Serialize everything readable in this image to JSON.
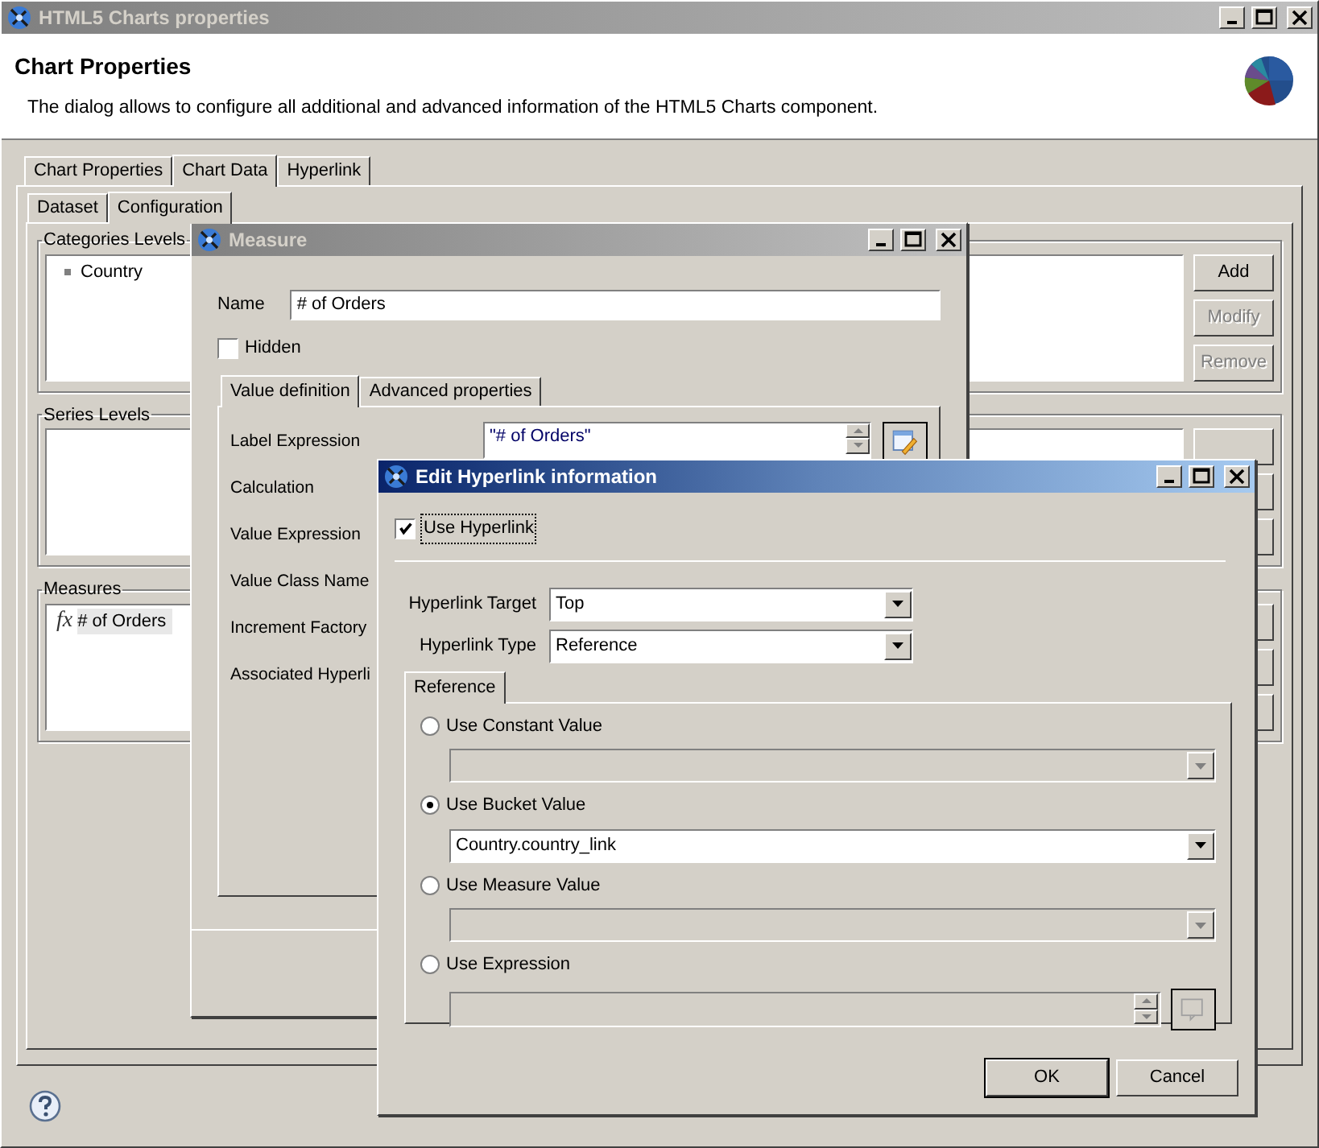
{
  "window": {
    "title": "HTML5 Charts properties",
    "active": false
  },
  "header": {
    "title": "Chart Properties",
    "description": "The dialog allows to configure all additional and advanced information of the HTML5 Charts component."
  },
  "tabs": [
    {
      "label": "Chart Properties",
      "selected": false
    },
    {
      "label": "Chart Data",
      "selected": true
    },
    {
      "label": "Hyperlink",
      "selected": false
    }
  ],
  "subtabs": [
    {
      "label": "Dataset",
      "selected": false
    },
    {
      "label": "Configuration",
      "selected": true
    }
  ],
  "categories_levels": {
    "title": "Categories Levels",
    "items": [
      "Country"
    ],
    "buttons": [
      {
        "label": "Add",
        "disabled": false
      },
      {
        "label": "Modify",
        "disabled": true
      },
      {
        "label": "Remove",
        "disabled": true
      }
    ]
  },
  "series_levels": {
    "title": "Series Levels"
  },
  "measures": {
    "title": "Measures",
    "items": [
      {
        "icon": "fx",
        "label": "# of Orders"
      }
    ]
  },
  "measure_dialog": {
    "title": "Measure",
    "active": false,
    "name_label": "Name",
    "name_value": "# of Orders",
    "hidden": {
      "label": "Hidden",
      "checked": false
    },
    "tabs": [
      {
        "label": "Value definition",
        "selected": true
      },
      {
        "label": "Advanced properties",
        "selected": false
      }
    ],
    "field_labels": [
      "Label Expression",
      "Calculation",
      "Value Expression",
      "Value Class Name",
      "Increment Factory",
      "Associated Hyperli"
    ],
    "label_expression": "\"# of Orders\""
  },
  "hyperlink_dialog": {
    "title": "Edit Hyperlink information",
    "active": true,
    "use_hyperlink": {
      "label": "Use Hyperlink",
      "checked": true
    },
    "target": {
      "label": "Hyperlink Target",
      "value": "Top"
    },
    "type": {
      "label": "Hyperlink Type",
      "value": "Reference"
    },
    "tab": {
      "label": "Reference",
      "selected": true
    },
    "options": [
      {
        "label": "Use Constant Value",
        "selected": false,
        "kind": "combo",
        "disabled": true
      },
      {
        "label": "Use Bucket Value",
        "selected": true,
        "kind": "combo",
        "disabled": false,
        "value": "Country.country_link"
      },
      {
        "label": "Use Measure Value",
        "selected": false,
        "kind": "combo",
        "disabled": true
      },
      {
        "label": "Use Expression",
        "selected": false,
        "kind": "expression",
        "disabled": true
      }
    ],
    "buttons": [
      "OK",
      "Cancel"
    ]
  }
}
